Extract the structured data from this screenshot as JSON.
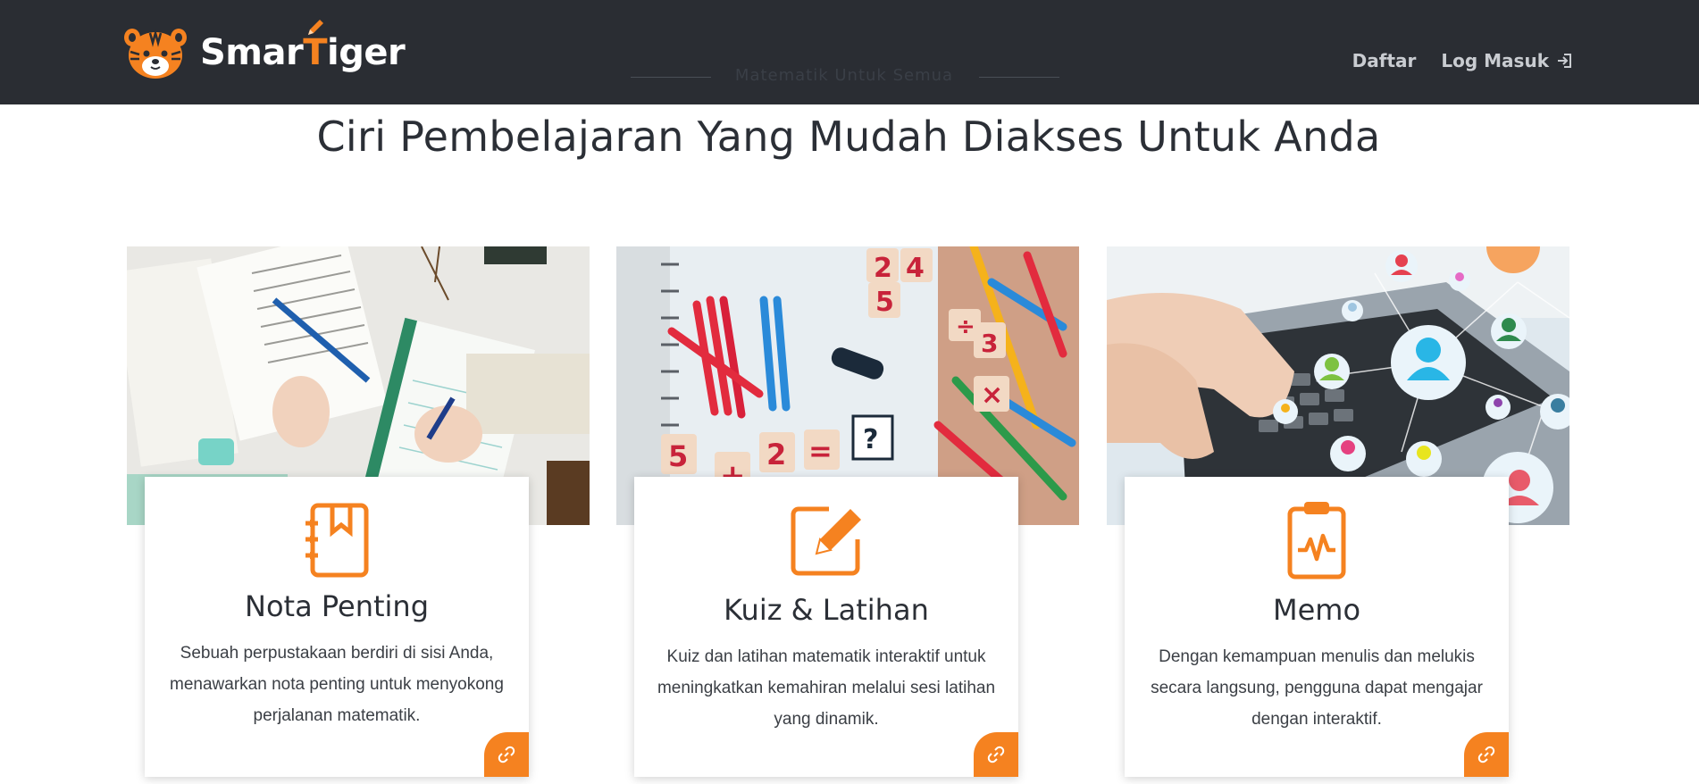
{
  "brand": {
    "name_part1": "Smar",
    "name_accent": "T",
    "name_part2": "iger",
    "accent_color": "#f58220"
  },
  "nav": {
    "ghost_text": "Matematik Untuk Semua",
    "links": [
      {
        "label": "Daftar"
      },
      {
        "label": "Log Masuk"
      }
    ]
  },
  "section": {
    "title": "Ciri Pembelajaran Yang Mudah Diakses Untuk Anda"
  },
  "features": [
    {
      "title": "Nota Penting",
      "description": "Sebuah perpustakaan berdiri di sisi Anda, menawarkan nota penting untuk menyokong perjalanan matematik.",
      "icon": "notebook-bookmark-icon"
    },
    {
      "title": "Kuiz & Latihan",
      "description": "Kuiz dan latihan matematik interaktif untuk meningkatkan kemahiran melalui sesi latihan yang dinamik.",
      "icon": "pencil-square-icon"
    },
    {
      "title": "Memo",
      "description": "Dengan kemampuan menulis dan melukis secara langsung, pengguna dapat mengajar dengan interaktif.",
      "icon": "clipboard-pulse-icon"
    }
  ],
  "colors": {
    "navbar": "#2a2d33",
    "accent": "#f58220",
    "text": "#2b2f36"
  }
}
